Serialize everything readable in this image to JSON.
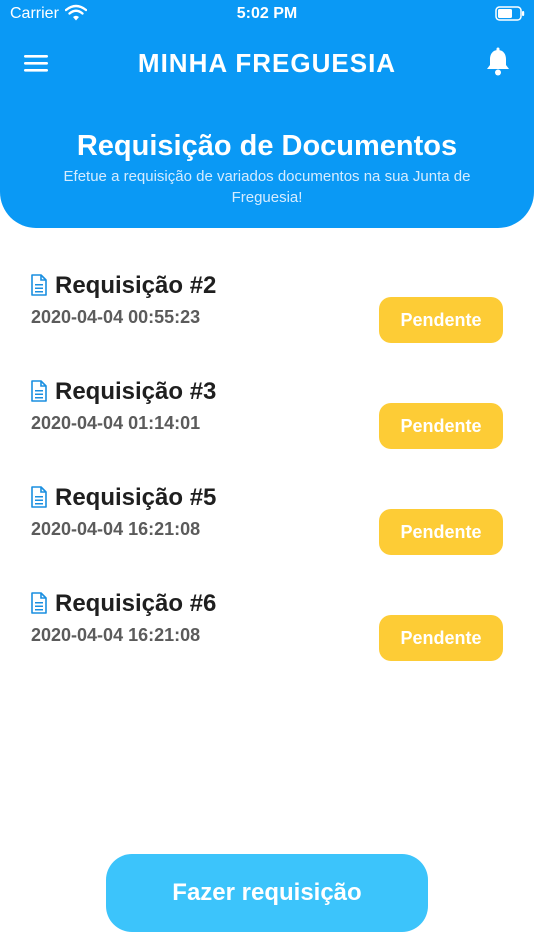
{
  "status_bar": {
    "carrier": "Carrier",
    "time": "5:02 PM",
    "wifi_icon": "wifi-icon",
    "battery_icon": "battery-icon"
  },
  "header": {
    "menu_icon": "hamburger-menu-icon",
    "app_title": "MINHA FREGUESIA",
    "bell_icon": "bell-icon",
    "page_title": "Requisição de Documentos",
    "page_subtitle": "Efetue a requisição de variados documentos na sua Junta de Freguesia!",
    "background_color": "#0a99f5"
  },
  "requests": [
    {
      "title": "Requisição #2",
      "date": "2020-04-04 00:55:23",
      "status": "Pendente",
      "icon": "document-icon"
    },
    {
      "title": "Requisição #3",
      "date": "2020-04-04 01:14:01",
      "status": "Pendente",
      "icon": "document-icon"
    },
    {
      "title": "Requisição #5",
      "date": "2020-04-04 16:21:08",
      "status": "Pendente",
      "icon": "document-icon"
    },
    {
      "title": "Requisição #6",
      "date": "2020-04-04 16:21:08",
      "status": "Pendente",
      "icon": "document-icon"
    }
  ],
  "status_color": "#fdcc36",
  "cta": {
    "label": "Fazer requisição",
    "color": "#3cc4fb"
  }
}
